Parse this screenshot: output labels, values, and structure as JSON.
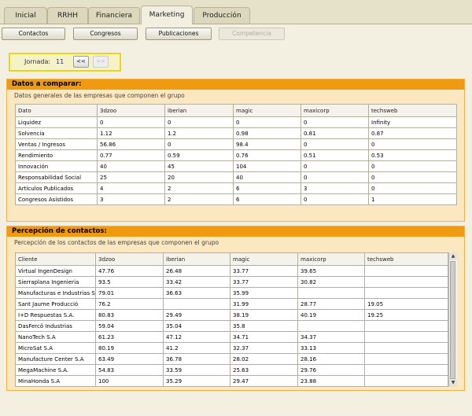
{
  "tabs": [
    {
      "label": "Inicial",
      "active": false
    },
    {
      "label": "RRHH",
      "active": false
    },
    {
      "label": "Financiera",
      "active": false
    },
    {
      "label": "Marketing",
      "active": true
    },
    {
      "label": "Producción",
      "active": false
    }
  ],
  "subtabs": [
    {
      "label": "Contactos",
      "disabled": false
    },
    {
      "label": "Congresos",
      "disabled": false
    },
    {
      "label": "Publicaciones",
      "disabled": false
    },
    {
      "label": "Competencia",
      "disabled": true
    }
  ],
  "jornada": {
    "label": "Jornada:",
    "value": "11",
    "prev": "<<",
    "next": ">>"
  },
  "datos": {
    "title": "Datos a comparar:",
    "description": "Datos generales de las empresas que componen el grupo",
    "columns": [
      "Dato",
      "3dzoo",
      "iberian",
      "magic",
      "maxicorp",
      "techsweb"
    ],
    "rows": [
      [
        "Liquidez",
        "0",
        "0",
        "0",
        "0",
        "Infinity"
      ],
      [
        "Solvencia",
        "1.12",
        "1.2",
        "0.98",
        "0.81",
        "0.87"
      ],
      [
        "Ventas / Ingresos",
        "56.86",
        "0",
        "98.4",
        "0",
        "0"
      ],
      [
        "Rendimiento",
        "0.77",
        "0.59",
        "0.76",
        "0.51",
        "0.53"
      ],
      [
        "Innovación",
        "40",
        "45",
        "104",
        "0",
        "0"
      ],
      [
        "Responsabilidad Social",
        "25",
        "20",
        "40",
        "0",
        "0"
      ],
      [
        "Artículos Publicados",
        "4",
        "2",
        "6",
        "3",
        "0"
      ],
      [
        "Congresos Asistidos",
        "3",
        "2",
        "6",
        "0",
        "1"
      ]
    ]
  },
  "percepcion": {
    "title": "Percepción de contactos:",
    "description": "Percepción de los contactos de las empresas que componen el grupo",
    "columns": [
      "Cliente",
      "3dzoo",
      "iberian",
      "magic",
      "maxicorp",
      "techsweb"
    ],
    "rows": [
      [
        "Virtual IngenDesign",
        "47.76",
        "26.48",
        "33.77",
        "39.65",
        ""
      ],
      [
        "Sierraplana Ingenieria",
        "93.5",
        "33.42",
        "33.77",
        "30.82",
        ""
      ],
      [
        "Manufacturas e Industrias S",
        "79.01",
        "36.63",
        "35.99",
        "",
        ""
      ],
      [
        "Sant Jaume Producció",
        "76.2",
        "",
        "31.99",
        "28.77",
        "19.05"
      ],
      [
        "I+D Respuestas S.A.",
        "80.83",
        "29.49",
        "38.19",
        "40.19",
        "19.25"
      ],
      [
        "DasFercö Industrias",
        "59.04",
        "35.04",
        "35.8",
        "",
        ""
      ],
      [
        "NanoTech S.A",
        "61.23",
        "47.12",
        "34.71",
        "34.37",
        ""
      ],
      [
        "MicroSat S.A",
        "80.19",
        "41.2",
        "32.37",
        "33.13",
        ""
      ],
      [
        "Manufacture Center S.A",
        "63.49",
        "36.78",
        "28.02",
        "28.16",
        ""
      ],
      [
        "MegaMachine S.A.",
        "54.83",
        "33.59",
        "25.63",
        "29.76",
        ""
      ],
      [
        "MinaHonda S.A",
        "100",
        "35.29",
        "29.47",
        "23.88",
        ""
      ]
    ]
  },
  "icons": {
    "scroll_up": "triangle-up",
    "scroll_down": "triangle-down",
    "grip": "grip-lines"
  }
}
